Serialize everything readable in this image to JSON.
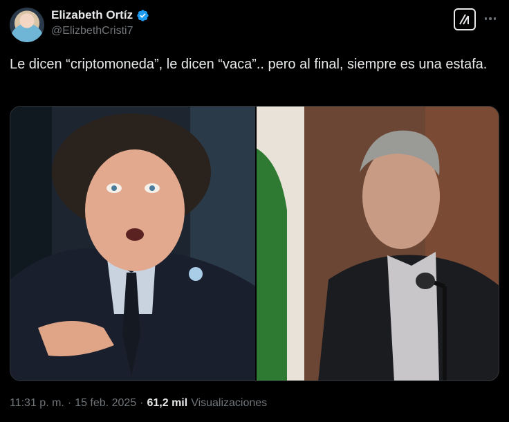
{
  "author": {
    "display_name": "Elizabeth Ortíz",
    "handle": "@ElizbethCristi7",
    "verified": true
  },
  "tweet": {
    "text": "Le dicen “criptomoneda”, le dicen “vaca”.. pero al final, siempre es una estafa."
  },
  "meta": {
    "time": "11:31 p. m.",
    "separator": "·",
    "date": "15 feb. 2025",
    "separator2": "·",
    "views_count": "61,2 mil",
    "views_label": "Visualizaciones"
  },
  "icons": {
    "verified": "verified-badge-icon",
    "grok": "grok-icon",
    "more": "more-options-icon"
  },
  "colors": {
    "background": "#000000",
    "text_primary": "#e7e9ea",
    "text_secondary": "#71767b",
    "verified_blue": "#1d9bf0"
  }
}
